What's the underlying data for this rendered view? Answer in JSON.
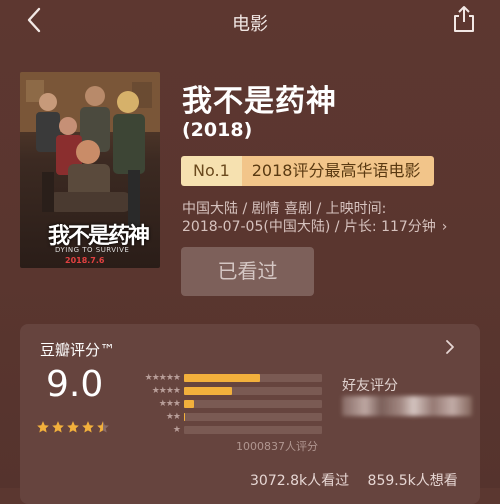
{
  "nav": {
    "title": "电影",
    "back_icon": "chevron-left-icon",
    "share_icon": "share-icon"
  },
  "movie": {
    "title": "我不是药神",
    "year": "(2018)",
    "rank_no": "No.1",
    "rank_text": "2018评分最高华语电影",
    "info_line1": "中国大陆 / 剧情 喜剧 / 上映时间:",
    "info_line2": "2018-07-05(中国大陆) / 片长: 117分钟",
    "info_chevron": "›",
    "watched_button": "已看过",
    "poster": {
      "title_text": "我不是药神",
      "subtitle_text": "DYING TO SURVIVE",
      "date_text": "2018.7.6"
    }
  },
  "rating": {
    "label": "豆瓣评分™",
    "score": "9.0",
    "score_stars": 4.5,
    "star_color": "#f2b03c",
    "vote_count": "1000837人评分",
    "friends_label": "好友评分",
    "distribution": [
      {
        "stars": 5,
        "label": "★★★★★",
        "fraction": 0.55
      },
      {
        "stars": 4,
        "label": "★★★★",
        "fraction": 0.35
      },
      {
        "stars": 3,
        "label": "★★★",
        "fraction": 0.07
      },
      {
        "stars": 2,
        "label": "★★",
        "fraction": 0.01
      },
      {
        "stars": 1,
        "label": "★",
        "fraction": 0.0
      }
    ],
    "watched_count": "3072.8k人看过",
    "want_count": "859.5k人想看"
  }
}
